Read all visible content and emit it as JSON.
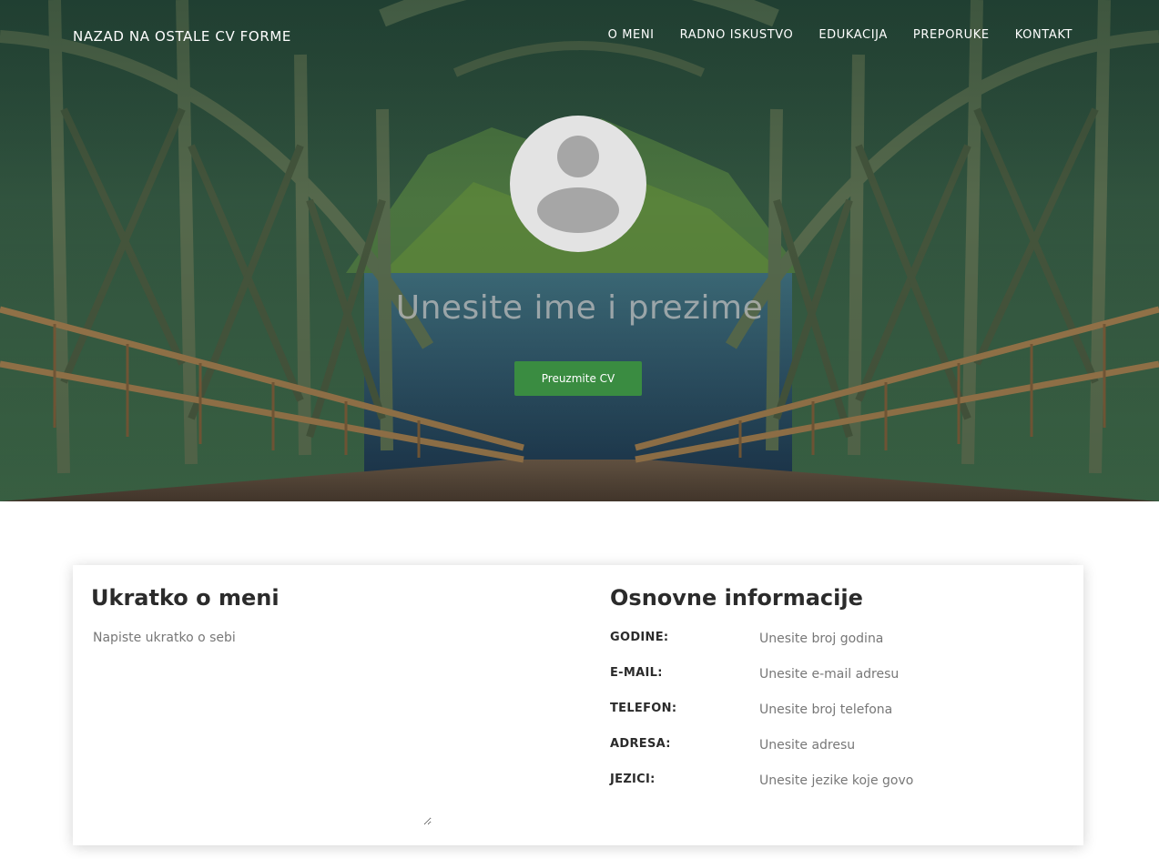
{
  "nav": {
    "back_label": "NAZAD NA OSTALE CV FORME",
    "items": [
      {
        "label": "O MENI"
      },
      {
        "label": "RADNO ISKUSTVO"
      },
      {
        "label": "EDUKACIJA"
      },
      {
        "label": "PREPORUKE"
      },
      {
        "label": "KONTAKT"
      }
    ]
  },
  "hero": {
    "name_placeholder": "Unesite ime i prezime",
    "download_label": "Preuzmite CV",
    "avatar_icon": "user-avatar-icon",
    "button_color": "#3a8c41"
  },
  "about": {
    "title": "Ukratko o meni",
    "placeholder": "Napiste ukratko o sebi"
  },
  "info": {
    "title": "Osnovne informacije",
    "rows": [
      {
        "label": "GODINE:",
        "placeholder": "Unesite broj godina"
      },
      {
        "label": "E-MAIL:",
        "placeholder": "Unesite e-mail adresu"
      },
      {
        "label": "TELEFON:",
        "placeholder": "Unesite broj telefona"
      },
      {
        "label": "ADRESA:",
        "placeholder": "Unesite adresu"
      },
      {
        "label": "JEZICI:",
        "placeholder": "Unesite jezike koje govorite"
      }
    ]
  }
}
